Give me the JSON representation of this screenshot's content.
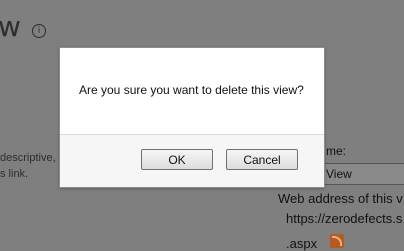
{
  "background": {
    "title_fragment": "w",
    "info_icon": "info-icon",
    "desc_line1": "descriptive,",
    "desc_line2": "s link.",
    "name_label": "me:",
    "name_value": "View",
    "web_address_label": "Web address of this v",
    "url": "https://zerodefects.s",
    "url_suffix": ".aspx",
    "rss_icon": "rss-icon"
  },
  "dialog": {
    "message": "Are you sure you want to delete this view?",
    "ok_label": "OK",
    "cancel_label": "Cancel"
  }
}
